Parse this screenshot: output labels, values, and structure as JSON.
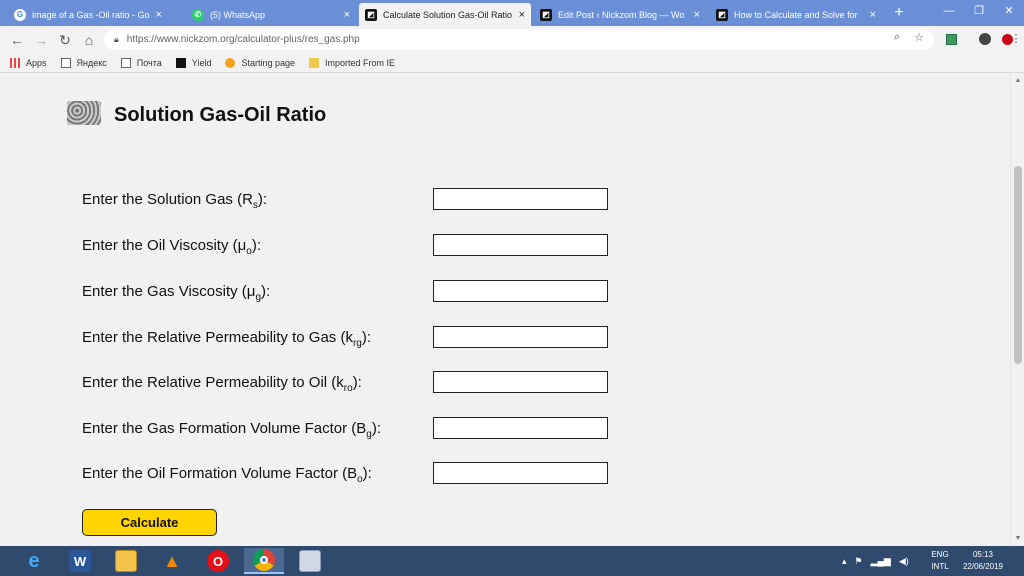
{
  "browser": {
    "tabs": [
      {
        "title": "image of a Gas -Oil ratio - Goog",
        "icon": "google-icon",
        "active": false
      },
      {
        "title": "(5) WhatsApp",
        "icon": "whatsapp-icon",
        "active": false
      },
      {
        "title": "Calculate Solution Gas-Oil Ratio",
        "icon": "nickzom-icon",
        "active": true
      },
      {
        "title": "Edit Post ‹ Nickzom Blog — Wo",
        "icon": "nickzom-icon",
        "active": false
      },
      {
        "title": "How to Calculate and Solve for",
        "icon": "nickzom-icon",
        "active": false
      }
    ],
    "tab_close": "×",
    "new_tab": "+",
    "window_controls": {
      "minimize": "—",
      "restore": "❐",
      "close": "✕"
    },
    "url": "https://www.nickzom.org/calculator-plus/res_gas.php",
    "bookmarks": [
      {
        "label": "Apps",
        "icon": "apps-icon"
      },
      {
        "label": "Яндекс",
        "icon": "page-icon"
      },
      {
        "label": "Почта",
        "icon": "page-icon"
      },
      {
        "label": "Yield",
        "icon": "nickzom-icon"
      },
      {
        "label": "Starting page",
        "icon": "starting-page-icon"
      },
      {
        "label": "Imported From IE",
        "icon": "folder-icon"
      }
    ]
  },
  "page": {
    "title": "Solution Gas-Oil Ratio",
    "fields": [
      {
        "label": "Enter the Solution Gas (R",
        "sub": "s",
        "suffix": "):",
        "value": ""
      },
      {
        "label": "Enter the Oil Viscosity (μ",
        "sub": "o",
        "suffix": "):",
        "value": ""
      },
      {
        "label": "Enter the Gas Viscosity (μ",
        "sub": "g",
        "suffix": "):",
        "value": ""
      },
      {
        "label": "Enter the Relative Permeability to Gas (k",
        "sub": "rg",
        "suffix": "):",
        "value": ""
      },
      {
        "label": "Enter the Relative Permeability to Oil (k",
        "sub": "ro",
        "suffix": "):",
        "value": ""
      },
      {
        "label": "Enter the Gas Formation Volume Factor (B",
        "sub": "g",
        "suffix": "):",
        "value": ""
      },
      {
        "label": "Enter the Oil Formation Volume Factor (B",
        "sub": "o",
        "suffix": "):",
        "value": ""
      }
    ],
    "calculate_label": "Calculate",
    "accent_color": "#ffd400"
  },
  "taskbar": {
    "apps": [
      "internet-explorer-icon",
      "word-icon",
      "file-explorer-icon",
      "vlc-icon",
      "opera-icon",
      "chrome-icon",
      "calculator-icon"
    ],
    "language_line1": "ENG",
    "language_line2": "INTL",
    "time": "05:13",
    "date": "22/06/2019"
  }
}
